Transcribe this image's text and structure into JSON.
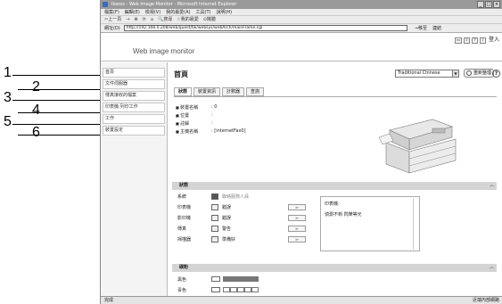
{
  "callouts": [
    "1",
    "2",
    "3",
    "4",
    "5",
    "6"
  ],
  "browser": {
    "title": "Ikaros - Web Image Monitor - Microsoft Internet Explorer",
    "window_buttons": [
      "_",
      "□",
      "×"
    ],
    "menu": [
      "檔案(F)",
      "編輯(E)",
      "檢視(V)",
      "我的最愛(A)",
      "工具(T)",
      "說明(H)"
    ],
    "toolbar": [
      "⇦上一頁",
      "→",
      "⊗",
      "⟳",
      "⌂",
      "🔍搜尋",
      "☆我的最愛",
      "⊙媒體"
    ],
    "address_label": "網址(D)",
    "url": "http://192.168.0.208/web/guest/tw/websys/webArch/mainFrame.cgi",
    "go_label": "→移至",
    "links_label": "連結"
  },
  "app": {
    "brand": "Web image monitor",
    "header_icons": [
      "▭",
      "⌕",
      "?",
      "i"
    ],
    "logout_label": "登入"
  },
  "sidebar": {
    "items": [
      "首頁",
      "文件伺服器",
      "傳真接收的檔案",
      "印表機:列印工作",
      "工作",
      "裝置設定"
    ]
  },
  "main": {
    "title": "首頁",
    "language": "Traditional Chinese",
    "refresh_label": "重新整理",
    "help_label": "?",
    "tabs": [
      "狀態",
      "裝置資訊",
      "計數器",
      "查詢"
    ],
    "device_info": [
      {
        "k": "裝置名稱",
        "v": ": 0"
      },
      {
        "k": "位置",
        "v": ":"
      },
      {
        "k": "註解",
        "v": ":"
      },
      {
        "k": "主機名稱",
        "v": ": [internetFax0]"
      }
    ],
    "status_section": "狀態",
    "status_rows": [
      {
        "name": "系統",
        "value": "聯絡服務人員",
        "arrow": ""
      },
      {
        "name": "印表機",
        "value": "錯誤",
        "arrow": "≫"
      },
      {
        "name": "影印機",
        "value": "錯誤",
        "arrow": "≫"
      },
      {
        "name": "傳真",
        "value": "警告",
        "arrow": "≫"
      },
      {
        "name": "掃描器",
        "value": "準備好",
        "arrow": "≫"
      }
    ],
    "message_title": "印表機:",
    "message_text": "偵測不到 閃爍等光",
    "toner_section": "碳粉",
    "toner_rows": [
      {
        "name": "黑色",
        "level": 1.0
      },
      {
        "name": "青色",
        "level": 0.0
      }
    ],
    "section_toggle": "︿"
  },
  "statusbar": {
    "left": "完成",
    "right": "近端內部網路"
  }
}
